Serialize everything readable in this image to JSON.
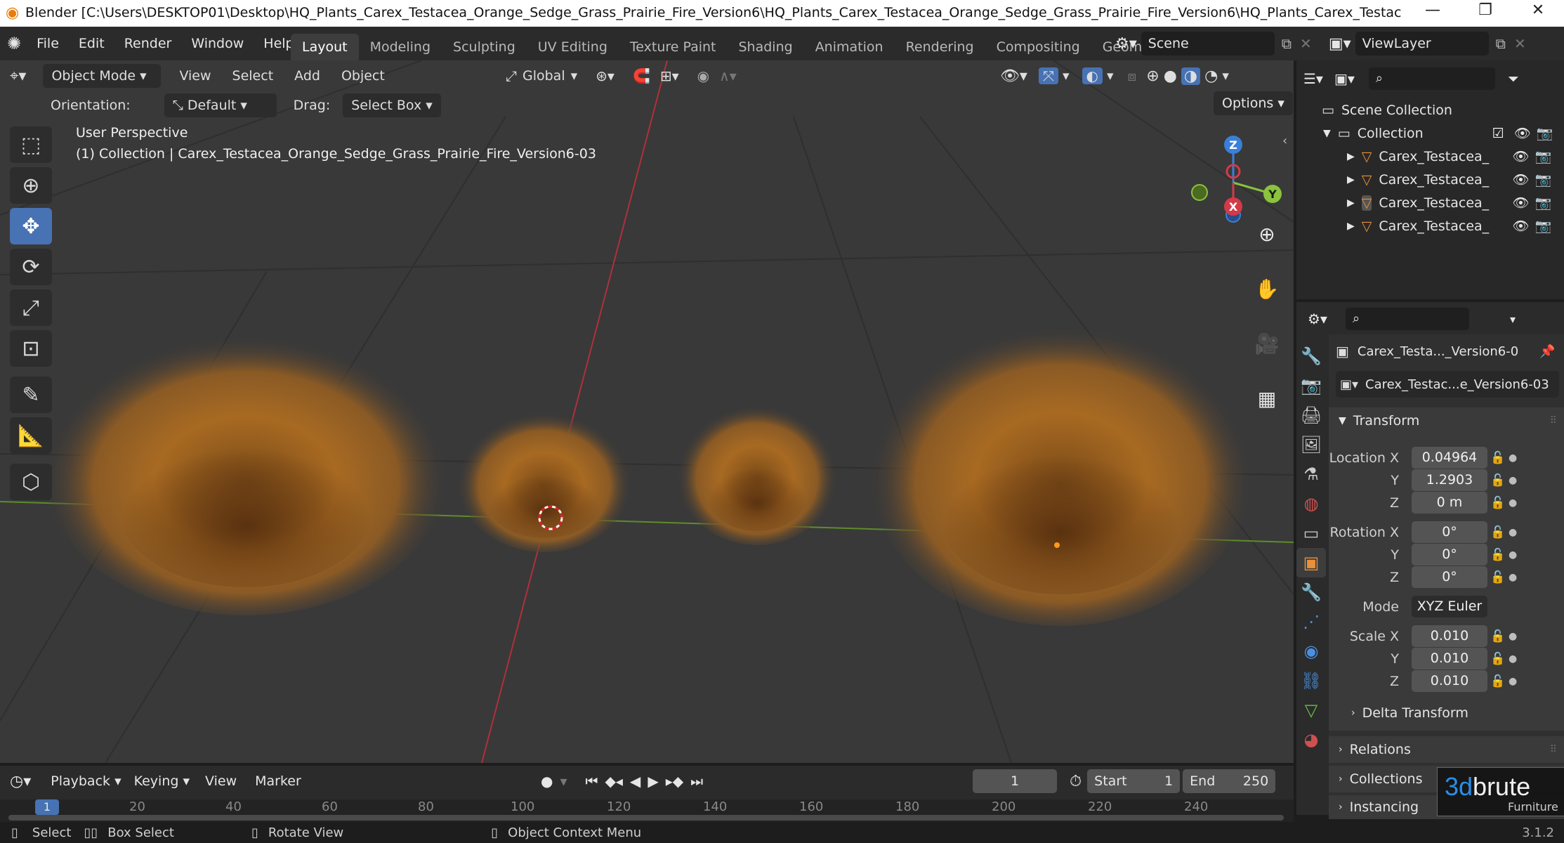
{
  "window": {
    "title": "Blender [C:\\Users\\DESKTOP01\\Desktop\\HQ_Plants_Carex_Testacea_Orange_Sedge_Grass_Prairie_Fire_Version6\\HQ_Plants_Carex_Testacea_Orange_Sedge_Grass_Prairie_Fire_Version6\\HQ_Plants_Carex_Testacea_Orange_Sedge_Gra...",
    "minimize": "—",
    "maximize": "❐",
    "close": "✕"
  },
  "menu": [
    "File",
    "Edit",
    "Render",
    "Window",
    "Help"
  ],
  "workspaces": [
    "Layout",
    "Modeling",
    "Sculpting",
    "UV Editing",
    "Texture Paint",
    "Shading",
    "Animation",
    "Rendering",
    "Compositing",
    "Geometry Nod"
  ],
  "scene": {
    "name": "Scene",
    "view_layer": "ViewLayer"
  },
  "viewport_header": {
    "mode": "Object Mode",
    "menus": [
      "View",
      "Select",
      "Add",
      "Object"
    ],
    "transform_orientation": "Global",
    "orientation_label": "Orientation:",
    "orientation_value": "Default",
    "drag_label": "Drag:",
    "drag_value": "Select Box",
    "options": "Options"
  },
  "viewport": {
    "perspective": "User Perspective",
    "collection_info": "(1) Collection | Carex_Testacea_Orange_Sedge_Grass_Prairie_Fire_Version6-03"
  },
  "gizmo": {
    "z": "Z",
    "y": "Y",
    "x": "X"
  },
  "outliner": {
    "scene_collection": "Scene Collection",
    "collection": "Collection",
    "items": [
      "Carex_Testacea_",
      "Carex_Testacea_",
      "Carex_Testacea_",
      "Carex_Testacea_"
    ]
  },
  "properties": {
    "object_name": "Carex_Testa..._Version6-0",
    "data_name": "Carex_Testac...e_Version6-03",
    "transform_title": "Transform",
    "location": {
      "label": "Location X",
      "x": "0.04964",
      "y": "1.2903",
      "z": "0 m"
    },
    "rotation": {
      "label": "Rotation X",
      "x": "0°",
      "y": "0°",
      "z": "0°"
    },
    "mode_label": "Mode",
    "mode_value": "XYZ Euler",
    "scale": {
      "label": "Scale X",
      "x": "0.010",
      "y": "0.010",
      "z": "0.010"
    },
    "y_label": "Y",
    "z_label": "Z",
    "delta": "Delta Transform",
    "relations": "Relations",
    "collections": "Collections",
    "instancing": "Instancing"
  },
  "watermark": {
    "brand_a": "3d",
    "brand_b": "brute",
    "sub": "Furniture"
  },
  "timeline": {
    "playback": "Playback",
    "keying": "Keying",
    "view": "View",
    "marker": "Marker",
    "current_frame": "1",
    "start_label": "Start",
    "start": "1",
    "end_label": "End",
    "end": "250",
    "ruler": [
      "1",
      "20",
      "40",
      "60",
      "80",
      "100",
      "120",
      "140",
      "160",
      "180",
      "200",
      "220",
      "240"
    ]
  },
  "status": {
    "select": "Select",
    "box_select": "Box Select",
    "rotate_view": "Rotate View",
    "context_menu": "Object Context Menu",
    "version": "3.1.2"
  }
}
